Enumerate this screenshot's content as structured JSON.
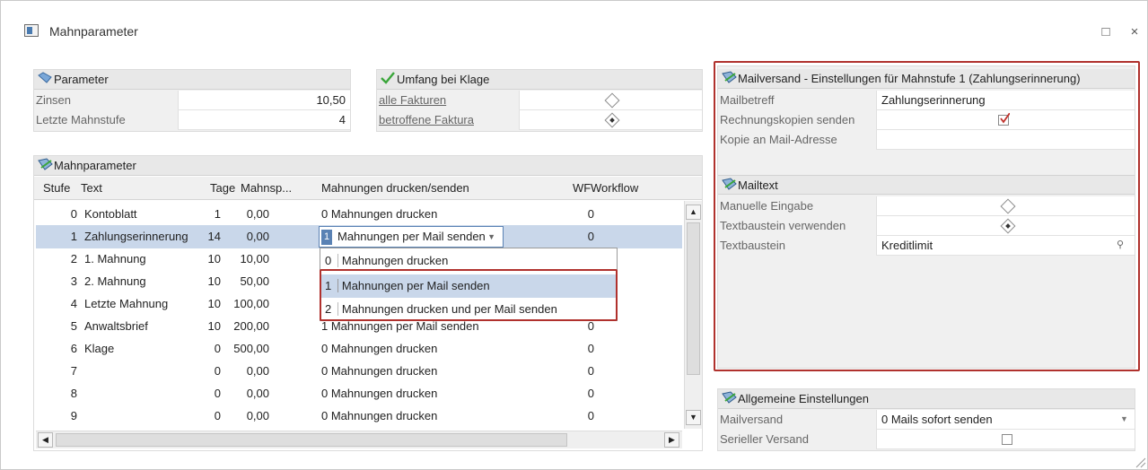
{
  "window": {
    "title": "Mahnparameter",
    "maximize_icon": "maximize-icon",
    "close_label": "×"
  },
  "parameter": {
    "header": "Parameter",
    "rows": [
      {
        "label": "Zinsen",
        "value": "10,50"
      },
      {
        "label": "Letzte Mahnstufe",
        "value": "4"
      }
    ]
  },
  "umfang": {
    "header": "Umfang bei Klage",
    "rows": [
      {
        "label": "alle Fakturen",
        "selected": false
      },
      {
        "label": "betroffene Faktura",
        "selected": true
      }
    ]
  },
  "mahnparameter_grid": {
    "header": "Mahnparameter",
    "columns": [
      "Stufe",
      "Text",
      "Tage",
      "Mahnsp...",
      "Mahnungen drucken/senden",
      "WF",
      "Workflow"
    ],
    "rows": [
      {
        "stufe": "0",
        "text": "Kontoblatt",
        "tage": "1",
        "mahnsp": "0,00",
        "mode": "0 Mahnungen drucken",
        "wf": "0"
      },
      {
        "stufe": "1",
        "text": "Zahlungserinnerung",
        "tage": "14",
        "mahnsp": "0,00",
        "mode": "Mahnungen per Mail senden",
        "wf": "0"
      },
      {
        "stufe": "2",
        "text": "1. Mahnung",
        "tage": "10",
        "mahnsp": "10,00",
        "mode": "",
        "wf": ""
      },
      {
        "stufe": "3",
        "text": "2. Mahnung",
        "tage": "10",
        "mahnsp": "50,00",
        "mode": "",
        "wf": ""
      },
      {
        "stufe": "4",
        "text": "Letzte Mahnung",
        "tage": "10",
        "mahnsp": "100,00",
        "mode": "",
        "wf": ""
      },
      {
        "stufe": "5",
        "text": "Anwaltsbrief",
        "tage": "10",
        "mahnsp": "200,00",
        "mode": "1 Mahnungen per Mail senden",
        "wf": "0"
      },
      {
        "stufe": "6",
        "text": "Klage",
        "tage": "0",
        "mahnsp": "500,00",
        "mode": "0 Mahnungen drucken",
        "wf": "0"
      },
      {
        "stufe": "7",
        "text": "",
        "tage": "0",
        "mahnsp": "0,00",
        "mode": "0 Mahnungen drucken",
        "wf": "0"
      },
      {
        "stufe": "8",
        "text": "",
        "tage": "0",
        "mahnsp": "0,00",
        "mode": "0 Mahnungen drucken",
        "wf": "0"
      },
      {
        "stufe": "9",
        "text": "",
        "tage": "0",
        "mahnsp": "0,00",
        "mode": "0 Mahnungen drucken",
        "wf": "0"
      }
    ],
    "editor_value": "1",
    "dropdown_options": [
      {
        "num": "0",
        "label": "Mahnungen drucken"
      },
      {
        "num": "1",
        "label": "Mahnungen per Mail senden"
      },
      {
        "num": "2",
        "label": "Mahnungen drucken und per Mail senden"
      }
    ]
  },
  "mailversand": {
    "header": "Mailversand - Einstellungen für Mahnstufe 1 (Zahlungserinnerung)",
    "rows": [
      {
        "label": "Mailbetreff",
        "value": "Zahlungserinnerung"
      },
      {
        "label": "Rechnungskopien senden",
        "checked": true
      },
      {
        "label": "Kopie an Mail-Adresse",
        "value": ""
      }
    ]
  },
  "mailtext": {
    "header": "Mailtext",
    "rows": [
      {
        "label": "Manuelle Eingabe",
        "selected": false
      },
      {
        "label": "Textbaustein verwenden",
        "selected": true
      },
      {
        "label": "Textbaustein",
        "value": "Kreditlimit"
      }
    ]
  },
  "allgemein": {
    "header": "Allgemeine Einstellungen",
    "rows": [
      {
        "label": "Mailversand",
        "value": "0 Mails sofort senden"
      },
      {
        "label": "Serieller Versand",
        "checked": false
      }
    ]
  },
  "colors": {
    "accent_red": "#b0312d",
    "selection": "#c9d7ea"
  }
}
